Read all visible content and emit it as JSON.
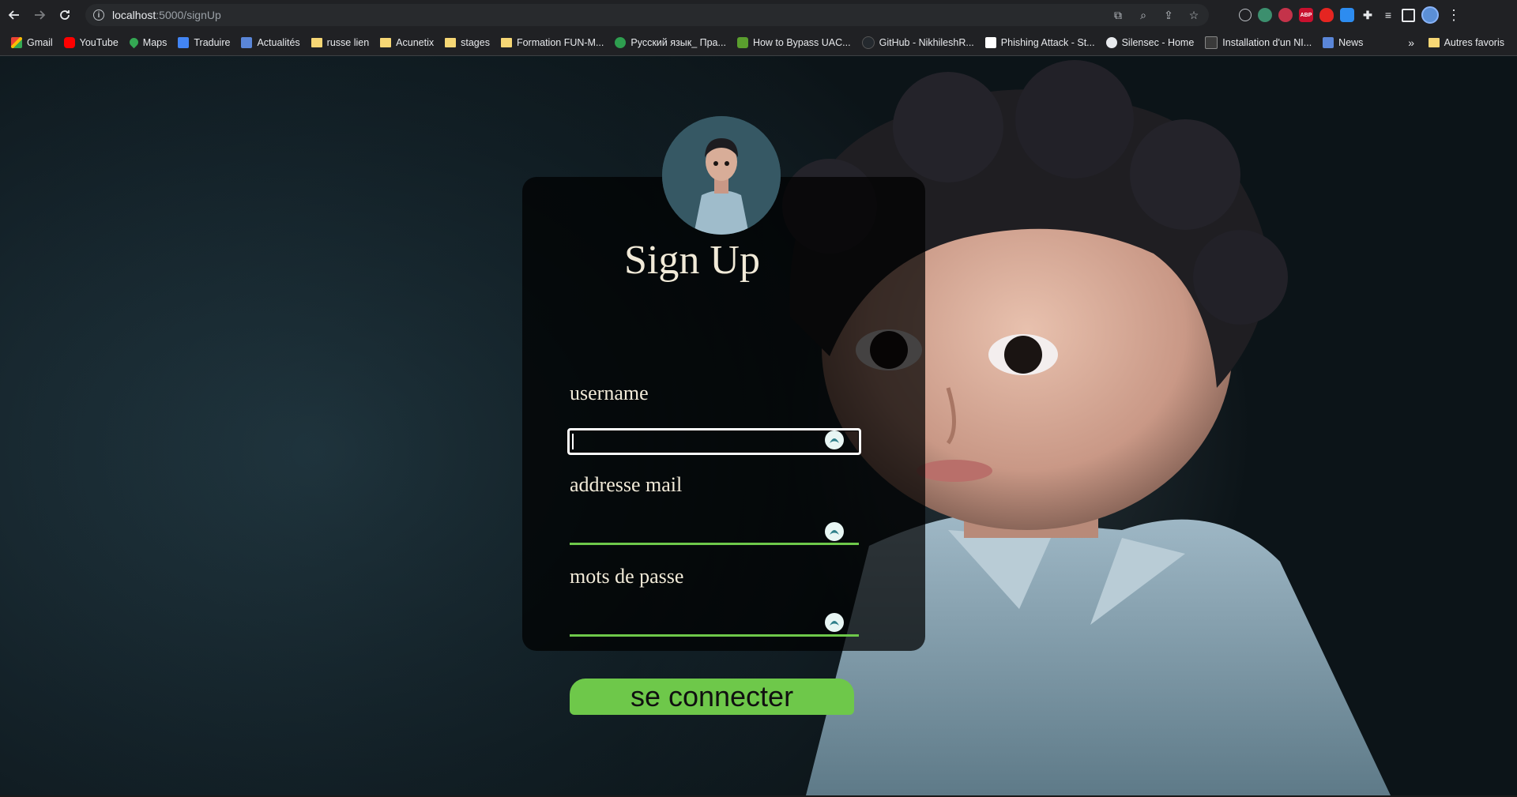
{
  "browser": {
    "url_host": "localhost",
    "url_path": ":5000/signUp",
    "bookmarks": [
      {
        "label": "Gmail",
        "icon": "gmail-icon"
      },
      {
        "label": "YouTube",
        "icon": "youtube-icon"
      },
      {
        "label": "Maps",
        "icon": "maps-icon"
      },
      {
        "label": "Traduire",
        "icon": "translate-icon"
      },
      {
        "label": "Actualités",
        "icon": "news-icon"
      },
      {
        "label": "russe lien",
        "icon": "folder-icon"
      },
      {
        "label": "Acunetix",
        "icon": "folder-icon"
      },
      {
        "label": "stages",
        "icon": "folder-icon"
      },
      {
        "label": "Formation FUN-M...",
        "icon": "folder-icon"
      },
      {
        "label": "Русский язык_ Пра...",
        "icon": "site-icon"
      },
      {
        "label": "How to Bypass UAC...",
        "icon": "site-icon"
      },
      {
        "label": "GitHub - NikhileshR...",
        "icon": "github-icon"
      },
      {
        "label": "Phishing Attack - St...",
        "icon": "site-icon"
      },
      {
        "label": "Silensec - Home",
        "icon": "site-icon"
      },
      {
        "label": "Installation d'un NI...",
        "icon": "site-icon"
      },
      {
        "label": "News",
        "icon": "news-icon"
      }
    ],
    "overflow": "»",
    "other_bookmarks": "Autres favoris",
    "extension_abp": "ABP"
  },
  "form": {
    "title": "Sign Up",
    "username_label": "username",
    "email_label": "addresse mail",
    "password_label": "mots de passe",
    "username_value": "",
    "email_value": "",
    "password_value": "",
    "submit_label": "se connecter"
  },
  "colors": {
    "accent": "#6ec84a",
    "text": "#f1ead8",
    "card": "rgba(0,0,0,0.72)"
  }
}
